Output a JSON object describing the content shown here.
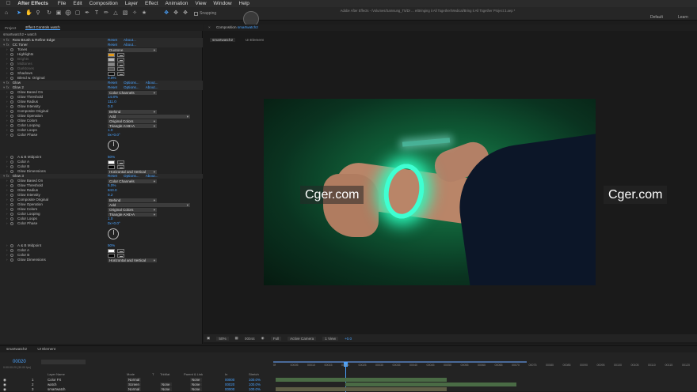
{
  "menubar": {
    "apple": "",
    "app": "After Effects",
    "items": [
      "File",
      "Edit",
      "Composition",
      "Layer",
      "Effect",
      "Animation",
      "View",
      "Window",
      "Help"
    ]
  },
  "toolbar": {
    "snapping_label": "Snapping",
    "window_title": "Adobe After Effects - /Volumes/Samsung_T5/Dr ... e/Bringing it All Together/Medical/Bring it All Together Project 3.aep *",
    "workspace_default": "Default",
    "workspace_learn": "Learn"
  },
  "left_panel": {
    "tab_project": "Project",
    "tab_effects": "Effect Controls watch",
    "path": "smartwatch2 • watch",
    "rows": [
      {
        "kind": "fx",
        "label": "Roto Brush & Refine Edge",
        "links": [
          "Reset",
          "About..."
        ]
      },
      {
        "kind": "fx",
        "label": "CC Toner",
        "links": [
          "Reset",
          "About..."
        ]
      },
      {
        "kind": "prop",
        "label": "Tones",
        "drop": "Duotone"
      },
      {
        "kind": "prop",
        "label": "Highlights",
        "swatch": "#e49a1a"
      },
      {
        "kind": "prop",
        "label": "Brights",
        "swatch": "#bbbbbb",
        "dim": true
      },
      {
        "kind": "prop",
        "label": "Midtones",
        "swatch": "#888888",
        "dim": true
      },
      {
        "kind": "prop",
        "label": "Darktones",
        "swatch": "#555555",
        "dim": true
      },
      {
        "kind": "prop",
        "label": "Shadows",
        "swatch": "#111111"
      },
      {
        "kind": "prop",
        "label": "Blend w. Original",
        "value": "0.0%"
      },
      {
        "kind": "fx",
        "label": "Glow",
        "links": [
          "Reset",
          "Options...",
          "About..."
        ]
      },
      {
        "kind": "fx",
        "label": "Glow 2",
        "links": [
          "Reset",
          "Options...",
          "About..."
        ]
      },
      {
        "kind": "prop",
        "label": "Glow Based On",
        "drop": "Color Channels"
      },
      {
        "kind": "prop",
        "label": "Glow Threshold",
        "value": "14.8%"
      },
      {
        "kind": "prop",
        "label": "Glow Radius",
        "value": "111.0"
      },
      {
        "kind": "prop",
        "label": "Glow Intensity",
        "value": "0.0"
      },
      {
        "kind": "prop",
        "label": "Composite Original",
        "drop": "Behind"
      },
      {
        "kind": "prop",
        "label": "Glow Operation",
        "drop": "Add",
        "wide": true
      },
      {
        "kind": "prop",
        "label": "Glow Colors",
        "drop": "Original Colors"
      },
      {
        "kind": "prop",
        "label": "Color Looping",
        "drop": "Triangle A>B>A"
      },
      {
        "kind": "prop",
        "label": "Color Loops",
        "value": "1.0"
      },
      {
        "kind": "prop",
        "label": "Color Phase",
        "value": "0x+0.0°"
      },
      {
        "kind": "dial"
      },
      {
        "kind": "prop",
        "label": "A & B Midpoint",
        "value": "50%"
      },
      {
        "kind": "prop",
        "label": "Color A",
        "swatch": "#ffffff"
      },
      {
        "kind": "prop",
        "label": "Color B",
        "swatch": "#000000"
      },
      {
        "kind": "prop",
        "label": "Glow Dimensions",
        "drop": "Horizontal and Vertical"
      },
      {
        "kind": "fx",
        "label": "Glow 3",
        "links": [
          "Reset",
          "Options...",
          "About..."
        ]
      },
      {
        "kind": "prop",
        "label": "Glow Based On",
        "drop": "Color Channels"
      },
      {
        "kind": "prop",
        "label": "Glow Threshold",
        "value": "5.0%"
      },
      {
        "kind": "prop",
        "label": "Glow Radius",
        "value": "843.0"
      },
      {
        "kind": "prop",
        "label": "Glow Intensity",
        "value": "0.2"
      },
      {
        "kind": "prop",
        "label": "Composite Original",
        "drop": "Behind"
      },
      {
        "kind": "prop",
        "label": "Glow Operation",
        "drop": "Add",
        "wide": true
      },
      {
        "kind": "prop",
        "label": "Glow Colors",
        "drop": "Original Colors"
      },
      {
        "kind": "prop",
        "label": "Color Looping",
        "drop": "Triangle A>B>A"
      },
      {
        "kind": "prop",
        "label": "Color Loops",
        "value": "1.0"
      },
      {
        "kind": "prop",
        "label": "Color Phase",
        "value": "0x+0.0°"
      },
      {
        "kind": "dial"
      },
      {
        "kind": "prop",
        "label": "A & B Midpoint",
        "value": "50%"
      },
      {
        "kind": "prop",
        "label": "Color A",
        "swatch": "#ffffff"
      },
      {
        "kind": "prop",
        "label": "Color B",
        "swatch": "#000000"
      },
      {
        "kind": "prop",
        "label": "Glow Dimensions",
        "drop": "Horizontal and Vertical"
      }
    ]
  },
  "comp": {
    "tab_label": "Composition",
    "tab_name": "smartwatch2",
    "flow_tabs": [
      "smartwatch2",
      "UI Element"
    ],
    "watermark_left": "Cger.com",
    "watermark_right": "Cger.com",
    "footer": {
      "zoom": "50%",
      "timecode": "00044",
      "resolution": "Full",
      "camera": "Active Camera",
      "views": "1 View",
      "offset": "+0.0"
    }
  },
  "timeline": {
    "tabs": [
      "smartwatch2",
      "UI Element"
    ],
    "timecode": "00020",
    "timecode_sub": "0:00:00:20 (30.00 fps)",
    "columns": [
      "Layer Name",
      "Mode",
      "T",
      "TrkMat",
      "Parent & Link",
      "In",
      "Stretch"
    ],
    "layers": [
      {
        "num": "1",
        "name": "Color FX",
        "mode": "Normal",
        "trk": "",
        "parent": "None",
        "in": "00000",
        "stretch": "100.0%"
      },
      {
        "num": "2",
        "name": "watch",
        "mode": "Screen",
        "trk": "None",
        "parent": "None",
        "in": "00020",
        "stretch": "100.0%"
      },
      {
        "num": "3",
        "name": "smartwatch",
        "mode": "Normal",
        "trk": "None",
        "parent": "None",
        "in": "00000",
        "stretch": "100.0%"
      }
    ],
    "ruler": [
      "0f",
      "00005",
      "00010",
      "00015",
      "00020",
      "00025",
      "00030",
      "00035",
      "00040",
      "00045",
      "00050",
      "00055",
      "00060",
      "00065",
      "00070",
      "00075",
      "00080",
      "00085",
      "00090",
      "00095",
      "00100",
      "00105",
      "00110",
      "00115",
      "00120"
    ]
  }
}
